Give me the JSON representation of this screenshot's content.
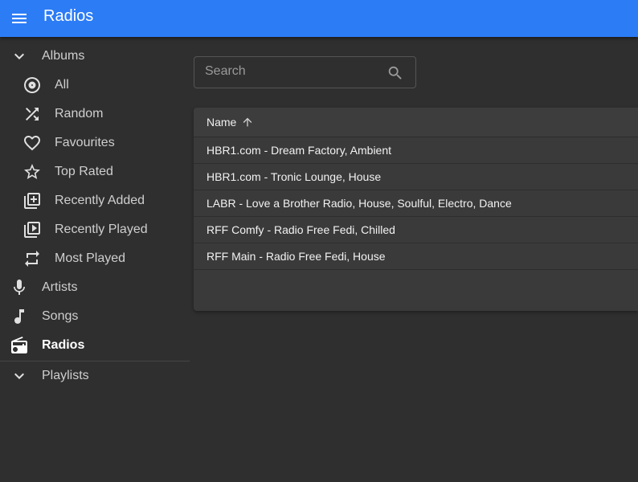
{
  "app": {
    "title": "Radios"
  },
  "sidebar": {
    "albums": "Albums",
    "album_items": [
      {
        "label": "All",
        "icon": "album-icon"
      },
      {
        "label": "Random",
        "icon": "shuffle-icon"
      },
      {
        "label": "Favourites",
        "icon": "heart-icon"
      },
      {
        "label": "Top Rated",
        "icon": "star-icon"
      },
      {
        "label": "Recently Added",
        "icon": "library-add-icon"
      },
      {
        "label": "Recently Played",
        "icon": "library-play-icon"
      },
      {
        "label": "Most Played",
        "icon": "repeat-icon"
      }
    ],
    "artists": "Artists",
    "songs": "Songs",
    "radios": "Radios",
    "playlists": "Playlists",
    "active": "Radios"
  },
  "search": {
    "placeholder": "Search",
    "value": ""
  },
  "table": {
    "column": "Name",
    "sort": "ascending",
    "rows": [
      "HBR1.com - Dream Factory, Ambient",
      "HBR1.com - Tronic Lounge, House",
      "LABR - Love a Brother Radio, House, Soulful, Electro, Dance",
      "RFF Comfy - Radio Free Fedi, Chilled",
      "RFF Main - Radio Free Fedi, House"
    ]
  },
  "colors": {
    "appbar": "#2c7cf6",
    "background": "#2f2f2f",
    "table": "#3a3a3a"
  }
}
